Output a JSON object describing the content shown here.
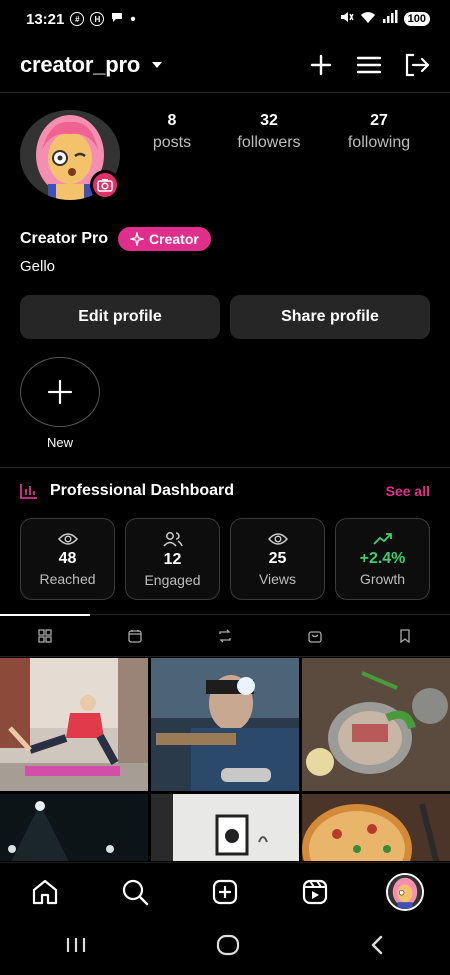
{
  "status": {
    "time": "13:21",
    "battery": "100"
  },
  "header": {
    "username": "creator_pro"
  },
  "profile": {
    "stats": [
      {
        "value": "8",
        "label": "posts"
      },
      {
        "value": "32",
        "label": "followers"
      },
      {
        "value": "27",
        "label": "following"
      }
    ],
    "display_name": "Creator Pro",
    "badge": "Creator",
    "bio": "Gello",
    "edit_button": "Edit profile",
    "share_button": "Share profile",
    "new_story_label": "New"
  },
  "dashboard": {
    "title": "Professional Dashboard",
    "see_all": "See all",
    "cards": [
      {
        "icon": "eye-icon",
        "value": "48",
        "label": "Reached"
      },
      {
        "icon": "people-icon",
        "value": "12",
        "label": "Engaged"
      },
      {
        "icon": "eye-icon",
        "value": "25",
        "label": "Views"
      },
      {
        "icon": "trend-up-icon",
        "value": "+2.4%",
        "label": "Growth"
      }
    ]
  },
  "tabs": [
    "grid-icon",
    "calendar-icon",
    "repost-icon",
    "shop-icon",
    "bookmark-icon"
  ],
  "colors": {
    "accent": "#e02f8a",
    "growth": "#3ad06a",
    "background": "#000000"
  }
}
